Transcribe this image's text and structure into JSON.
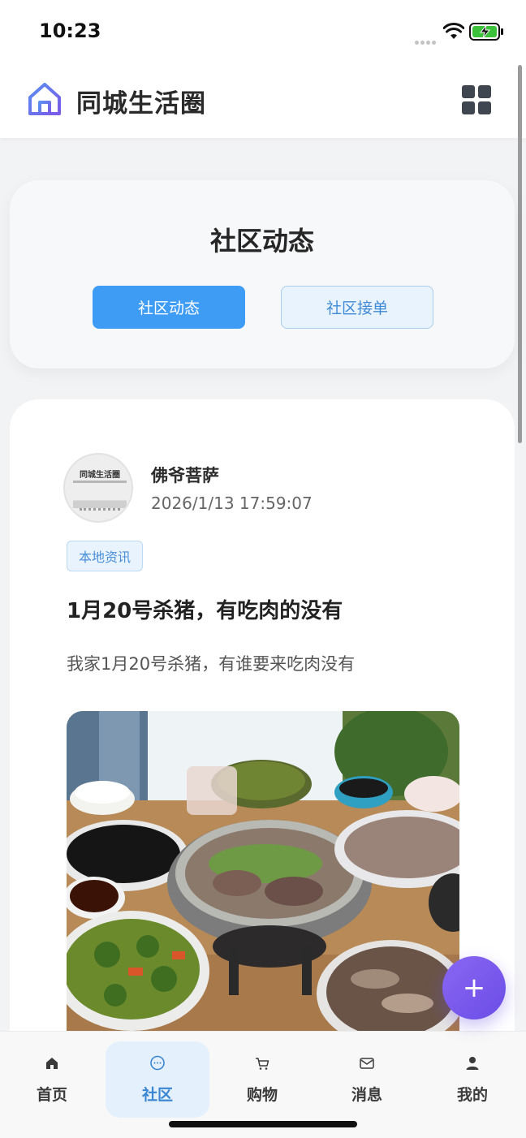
{
  "status_bar": {
    "time": "10:23"
  },
  "header": {
    "title": "同城生活圈",
    "logo_icon": "home-icon",
    "menu_icon": "grid-icon"
  },
  "tabs_card": {
    "title": "社区动态",
    "tabs": [
      {
        "label": "社区动态",
        "active": true
      },
      {
        "label": "社区接单",
        "active": false
      }
    ]
  },
  "post": {
    "avatar_text": "同城生活圈",
    "author": "佛爷菩萨",
    "time": "2026/1/13 17:59:07",
    "tag": "本地资讯",
    "title": "1月20号杀猪，有吃肉的没有",
    "body": "我家1月20号杀猪，有谁要来吃肉没有"
  },
  "fab": {
    "label": "+"
  },
  "bottom_nav": {
    "items": [
      {
        "label": "首页",
        "icon": "home-icon",
        "active": false
      },
      {
        "label": "社区",
        "icon": "chat-bubble-icon",
        "active": true
      },
      {
        "label": "购物",
        "icon": "cart-icon",
        "active": false
      },
      {
        "label": "消息",
        "icon": "mail-icon",
        "active": false
      },
      {
        "label": "我的",
        "icon": "user-icon",
        "active": false
      }
    ]
  },
  "colors": {
    "accent": "#3f9cf4",
    "fab": "#7b5cf0",
    "battery": "#3cc13b"
  }
}
